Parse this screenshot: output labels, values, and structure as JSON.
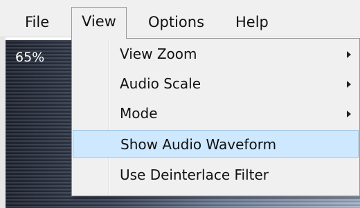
{
  "menubar": {
    "items": [
      {
        "label": "File"
      },
      {
        "label": "View"
      },
      {
        "label": "Options"
      },
      {
        "label": "Help"
      }
    ]
  },
  "view_menu": {
    "items": [
      {
        "label": "View Zoom",
        "submenu": true
      },
      {
        "label": "Audio Scale",
        "submenu": true
      },
      {
        "label": "Mode",
        "submenu": true
      },
      {
        "label": "Show Audio Waveform",
        "submenu": false,
        "highlighted": true
      },
      {
        "label": "Use Deinterlace Filter",
        "submenu": false
      }
    ]
  },
  "video": {
    "zoom_label": "65%"
  },
  "colors": {
    "menu_background": "#f0f0f0",
    "highlight_fill": "#cde8ff",
    "highlight_border": "#93c4ee"
  }
}
